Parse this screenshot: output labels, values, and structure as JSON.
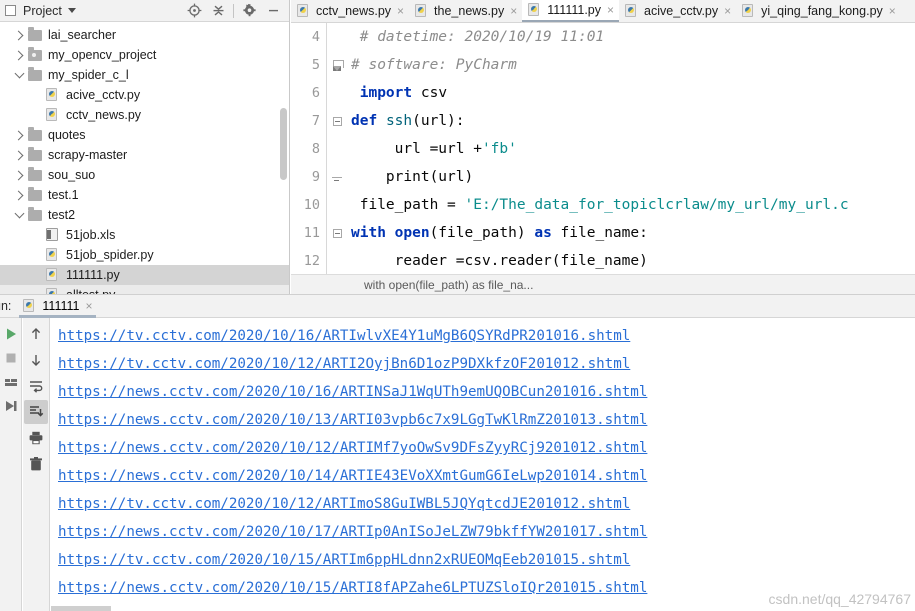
{
  "project_panel": {
    "title": "Project",
    "icons": [
      {
        "name": "locate-icon",
        "glyph": "locate"
      },
      {
        "name": "collapse-all-icon",
        "glyph": "collapse"
      },
      {
        "name": "settings-gear-icon",
        "glyph": "gear"
      },
      {
        "name": "minimize-icon",
        "glyph": "minus"
      }
    ],
    "tree": [
      {
        "label": "lai_searcher",
        "type": "folder",
        "indent": 1,
        "state": "collapsed",
        "selected": false
      },
      {
        "label": "my_opencv_project",
        "type": "folder-dot",
        "indent": 1,
        "state": "collapsed",
        "selected": false
      },
      {
        "label": "my_spider_c_l",
        "type": "folder",
        "indent": 1,
        "state": "expanded",
        "selected": false
      },
      {
        "label": "acive_cctv.py",
        "type": "python",
        "indent": 2,
        "state": "none",
        "selected": false
      },
      {
        "label": "cctv_news.py",
        "type": "python",
        "indent": 2,
        "state": "none",
        "selected": false
      },
      {
        "label": "quotes",
        "type": "folder",
        "indent": 1,
        "state": "collapsed",
        "selected": false
      },
      {
        "label": "scrapy-master",
        "type": "folder",
        "indent": 1,
        "state": "collapsed",
        "selected": false
      },
      {
        "label": "sou_suo",
        "type": "folder",
        "indent": 1,
        "state": "collapsed",
        "selected": false
      },
      {
        "label": "test.1",
        "type": "folder",
        "indent": 1,
        "state": "collapsed",
        "selected": false
      },
      {
        "label": "test2",
        "type": "folder",
        "indent": 1,
        "state": "expanded",
        "selected": false
      },
      {
        "label": "51job.xls",
        "type": "xls",
        "indent": 2,
        "state": "none",
        "selected": false
      },
      {
        "label": "51job_spider.py",
        "type": "python",
        "indent": 2,
        "state": "none",
        "selected": false
      },
      {
        "label": "111111.py",
        "type": "python",
        "indent": 2,
        "state": "none",
        "selected": true
      },
      {
        "label": "alltest.py",
        "type": "python",
        "indent": 2,
        "state": "none",
        "selected": false,
        "secondary": true
      }
    ]
  },
  "editor": {
    "tabs": [
      {
        "label": "cctv_news.py",
        "active": false
      },
      {
        "label": "the_news.py",
        "active": false
      },
      {
        "label": "111111.py",
        "active": true
      },
      {
        "label": "acive_cctv.py",
        "active": false
      },
      {
        "label": "yi_qing_fang_kong.py",
        "active": false
      }
    ],
    "lines": [
      {
        "num": "4",
        "fold": "none",
        "tokens": [
          {
            "t": " # datetime: 2020/10/19 11:01",
            "c": "cmt"
          }
        ]
      },
      {
        "num": "5",
        "fold": "end",
        "tokens": [
          {
            "t": "# software: PyCharm",
            "c": "cmt"
          }
        ]
      },
      {
        "num": "6",
        "fold": "none",
        "tokens": [
          {
            "t": " ",
            "c": "plain"
          },
          {
            "t": "import",
            "c": "kw"
          },
          {
            "t": " csv",
            "c": "plain"
          }
        ]
      },
      {
        "num": "7",
        "fold": "open",
        "tokens": [
          {
            "t": "def",
            "c": "kw"
          },
          {
            "t": " ",
            "c": "plain"
          },
          {
            "t": "ssh",
            "c": "fn"
          },
          {
            "t": "(url):",
            "c": "plain"
          }
        ]
      },
      {
        "num": "8",
        "fold": "none",
        "tokens": [
          {
            "t": "     url =url +",
            "c": "plain"
          },
          {
            "t": "'fb'",
            "c": "str"
          }
        ]
      },
      {
        "num": "9",
        "fold": "tick",
        "tokens": [
          {
            "t": "    print(url)",
            "c": "plain"
          }
        ]
      },
      {
        "num": "10",
        "fold": "none",
        "tokens": [
          {
            "t": " file_path = ",
            "c": "plain"
          },
          {
            "t": "'E:/The_data_for_topiclcrlaw/my_url/my_url.c",
            "c": "str"
          }
        ]
      },
      {
        "num": "11",
        "fold": "open",
        "tokens": [
          {
            "t": "with",
            "c": "kw"
          },
          {
            "t": " ",
            "c": "plain"
          },
          {
            "t": "open",
            "c": "kw"
          },
          {
            "t": "(file_path) ",
            "c": "plain"
          },
          {
            "t": "as",
            "c": "kw"
          },
          {
            "t": " file_name:",
            "c": "plain"
          }
        ]
      },
      {
        "num": "12",
        "fold": "none",
        "tokens": [
          {
            "t": "     reader =csv.reader(file_name)",
            "c": "plain"
          }
        ]
      }
    ],
    "breadcrumb": "with open(file_path) as file_na..."
  },
  "run_panel": {
    "label": "un:",
    "config_name": "111111",
    "close_glyph": "×",
    "left_tool_icons": [
      {
        "name": "run-icon"
      },
      {
        "name": "stop-icon"
      },
      {
        "name": "rerun-icon"
      },
      {
        "name": "resume-icon"
      }
    ],
    "tool_icons": [
      {
        "name": "scroll-up-icon",
        "active": false
      },
      {
        "name": "scroll-down-icon",
        "active": false
      },
      {
        "name": "soft-wrap-icon",
        "active": false
      },
      {
        "name": "scroll-to-end-icon",
        "active": true
      },
      {
        "name": "print-icon",
        "active": false
      },
      {
        "name": "clear-all-icon",
        "active": false
      }
    ],
    "output": [
      "https://tv.cctv.com/2020/10/16/ARTIwlvXE4Y1uMgB6QSYRdPR201016.shtml",
      "https://tv.cctv.com/2020/10/12/ARTI2OyjBn6D1ozP9DXkfzOF201012.shtml",
      "https://news.cctv.com/2020/10/16/ARTINSaJ1WqUTh9emUQOBCun201016.shtml",
      "https://news.cctv.com/2020/10/13/ARTI03vpb6c7x9LGgTwKlRmZ201013.shtml",
      "https://news.cctv.com/2020/10/12/ARTIMf7yoOwSv9DFsZyyRCj9201012.shtml",
      "https://news.cctv.com/2020/10/14/ARTIE43EVoXXmtGumG6IeLwp201014.shtml",
      "https://tv.cctv.com/2020/10/12/ARTImoS8GuIWBL5JQYqtcdJE201012.shtml",
      "https://news.cctv.com/2020/10/17/ARTIp0AnISoJeLZW79bkffYW201017.shtml",
      "https://tv.cctv.com/2020/10/15/ARTIm6ppHLdnn2xRUEOMqEeb201015.shtml",
      "https://news.cctv.com/2020/10/15/ARTI8fAPZahe6LPTUZSloIQr201015.shtml"
    ]
  },
  "watermark": "csdn.net/qq_42794767",
  "colors": {
    "link": "#2a6fd6",
    "keyword": "#0033b3",
    "string": "#0b8c8c",
    "comment": "#8c8c8c",
    "selection": "#d4d4d4",
    "panel_bg": "#f2f2f2"
  }
}
